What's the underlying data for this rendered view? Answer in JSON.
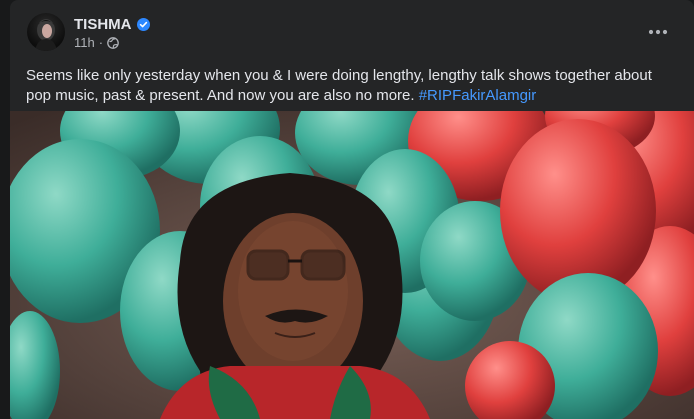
{
  "post": {
    "author_name": "TISHMA",
    "timestamp": "11h",
    "separator": "·",
    "caption_text": "Seems like only yesterday when you & I were doing lengthy, lengthy talk shows together about pop music, past & present. And now you are also no more. ",
    "hashtag": "#RIPFakirAlamgir",
    "icons": {
      "verified": "verified-badge-icon",
      "privacy": "globe-icon",
      "more": "more-options-icon"
    }
  },
  "colors": {
    "post_background": "#242526",
    "page_background": "#18191a",
    "primary_text": "#e4e6eb",
    "secondary_text": "#b0b3b8",
    "hashtag_link": "#4599ff",
    "verified_blue": "#2d88ff"
  }
}
